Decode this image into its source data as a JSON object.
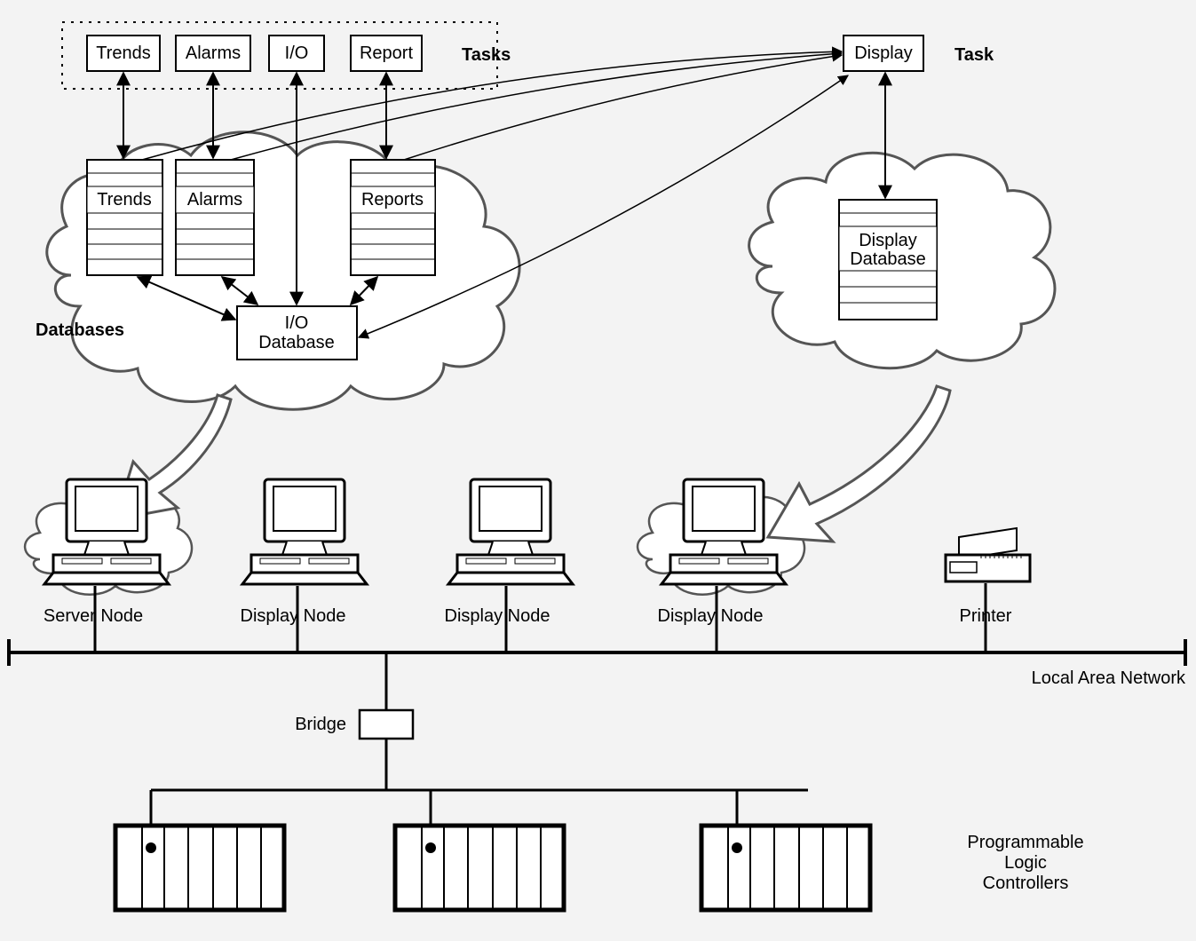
{
  "tasks_left": {
    "group_label": "Tasks",
    "items": [
      {
        "id": "trends",
        "label": "Trends"
      },
      {
        "id": "alarms",
        "label": "Alarms"
      },
      {
        "id": "io",
        "label": "I/O"
      },
      {
        "id": "report",
        "label": "Report"
      }
    ]
  },
  "task_right": {
    "group_label": "Task",
    "label": "Display"
  },
  "databases": {
    "group_label": "Databases",
    "trends": "Trends",
    "alarms": "Alarms",
    "reports": "Reports",
    "io": "I/O\nDatabase"
  },
  "display_db": "Display\nDatabase",
  "nodes": {
    "server": "Server Node",
    "display1": "Display Node",
    "display2": "Display Node",
    "display3": "Display Node",
    "printer": "Printer"
  },
  "lan": "Local Area Network",
  "bridge": "Bridge",
  "plc": "Programmable\nLogic\nControllers"
}
